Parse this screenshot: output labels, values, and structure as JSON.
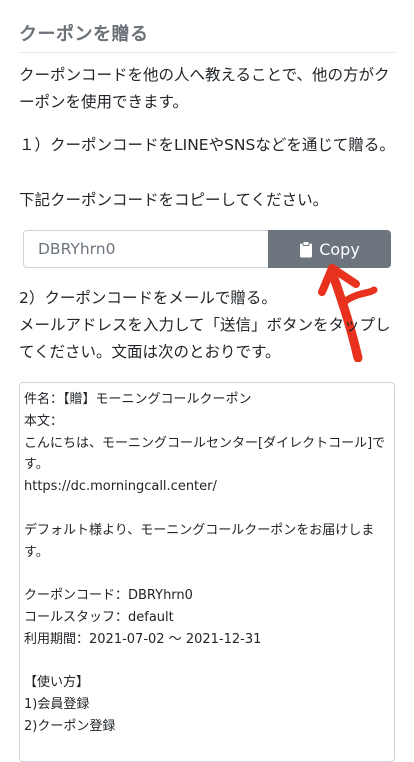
{
  "section": {
    "title": "クーポンを贈る"
  },
  "intro": "クーポンコードを他の人へ教えることで、他の方がクーポンを使用できます。",
  "step1": {
    "line1": "１）クーポンコードをLINEやSNSなどを通じて贈る。",
    "line2": "下記クーポンコードをコピーしてください。"
  },
  "coupon": {
    "code": "DBRYhrn0",
    "copy_label": "Copy",
    "copy_icon": "clipboard-icon",
    "arrow_color": "#e8321e"
  },
  "step2": {
    "line1": "2）クーポンコードをメールで贈る。",
    "line2": "メールアドレスを入力して「送信」ボタンをタップしてください。文面は次のとおりです。"
  },
  "mail_body": "件名：【贈】モーニングコールクーポン\n本文：\nこんにちは、モーニングコールセンター[ダイレクトコール]です。\nhttps://dc.morningcall.center/\n\nデフォルト様より、モーニングコールクーポンをお届けします。\n\nクーポンコード：DBRYhrn0\nコールスタッフ：default\n利用期間：2021-07-02 〜 2021-12-31\n\n【使い方】\n1)会員登録\n2)クーポン登録",
  "colors": {
    "button_bg": "#6c757d",
    "title": "#6b7178"
  }
}
